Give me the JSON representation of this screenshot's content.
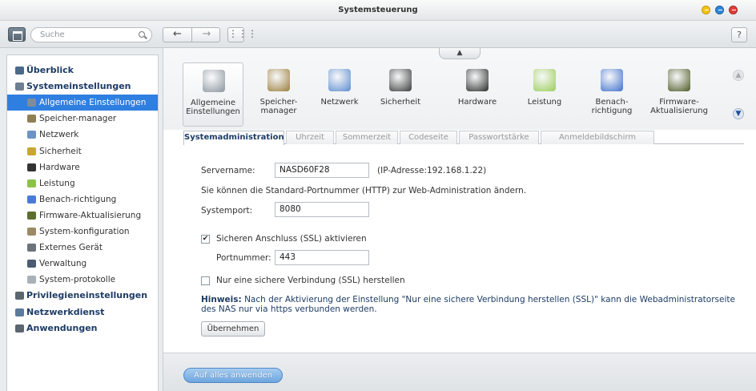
{
  "window": {
    "title": "Systemsteuerung"
  },
  "toolbar": {
    "search_placeholder": "Suche",
    "back": "←",
    "forward": "→",
    "grid": "⋮⋮⋮",
    "help": "?"
  },
  "sidebar": {
    "items": [
      {
        "label": "Überblick",
        "level": 0,
        "icon": "overview-icon",
        "color": "#4a6a8c"
      },
      {
        "label": "Systemeinstellungen",
        "level": 0,
        "icon": "gear-icon",
        "color": "#6d7f93"
      },
      {
        "label": "Allgemeine Einstellungen",
        "level": 1,
        "icon": "general-settings-icon",
        "color": "#7f8c99",
        "selected": true
      },
      {
        "label": "Speicher-manager",
        "level": 1,
        "icon": "storage-icon",
        "color": "#8e7f55"
      },
      {
        "label": "Netzwerk",
        "level": 1,
        "icon": "network-icon",
        "color": "#6d93c4"
      },
      {
        "label": "Sicherheit",
        "level": 1,
        "icon": "lock-icon",
        "color": "#c9a62d"
      },
      {
        "label": "Hardware",
        "level": 1,
        "icon": "hardware-icon",
        "color": "#333333"
      },
      {
        "label": "Leistung",
        "level": 1,
        "icon": "bulb-icon",
        "color": "#8bc34a"
      },
      {
        "label": "Benach-richtigung",
        "level": 1,
        "icon": "notification-icon",
        "color": "#4b7ad6"
      },
      {
        "label": "Firmware-Aktualisierung",
        "level": 1,
        "icon": "firmware-icon",
        "color": "#5c6e2d"
      },
      {
        "label": "System-konfiguration",
        "level": 1,
        "icon": "system-config-icon",
        "color": "#9c8a62"
      },
      {
        "label": "Externes Gerät",
        "level": 1,
        "icon": "external-device-icon",
        "color": "#6b737b"
      },
      {
        "label": "Verwaltung",
        "level": 1,
        "icon": "management-icon",
        "color": "#4a5b73"
      },
      {
        "label": "System-protokolle",
        "level": 1,
        "icon": "logs-icon",
        "color": "#a9b1b8"
      },
      {
        "label": "Privilegieneinstellungen",
        "level": 0,
        "icon": "user-icon",
        "color": "#5a6670"
      },
      {
        "label": "Netzwerkdienst",
        "level": 0,
        "icon": "network-service-icon",
        "color": "#5a7b9c"
      },
      {
        "label": "Anwendungen",
        "level": 0,
        "icon": "applications-icon",
        "color": "#5a6670"
      }
    ]
  },
  "categories": [
    {
      "label": "Allgemeine\nEinstellungen",
      "icon": "general-settings-icon",
      "color": "#8a949e",
      "selected": true
    },
    {
      "label": "Speicher-\nmanager",
      "icon": "storage-icon",
      "color": "#9b7d3a"
    },
    {
      "label": "Netzwerk",
      "icon": "network-icon",
      "color": "#5b8bd0"
    },
    {
      "label": "Sicherheit",
      "icon": "lock-icon",
      "color": "#3a3a3a"
    },
    {
      "label": "Hardware",
      "icon": "hardware-icon",
      "color": "#2a2a2a"
    },
    {
      "label": "Leistung",
      "icon": "bulb-icon",
      "color": "#9acd5a"
    },
    {
      "label": "Benach-\nrichtigung",
      "icon": "notification-icon",
      "color": "#3f6fcf"
    },
    {
      "label": "Firmware-\nAktualisierung",
      "icon": "firmware-icon",
      "color": "#4c5a24"
    }
  ],
  "tabs": [
    {
      "label": "Systemadministration",
      "active": true
    },
    {
      "label": "Uhrzeit"
    },
    {
      "label": "Sommerzeit"
    },
    {
      "label": "Codeseite"
    },
    {
      "label": "Passwortstärke"
    },
    {
      "label": "Anmeldebildschirm"
    }
  ],
  "form": {
    "servername_label": "Servername:",
    "servername_value": "NASD60F28",
    "ip_text": "(IP-Adresse:192.168.1.22)",
    "port_info": "Sie können die Standard-Portnummer (HTTP) zur Web-Administration ändern.",
    "systemport_label": "Systemport:",
    "systemport_value": "8080",
    "ssl_checkbox_label": "Sicheren Anschluss (SSL) aktivieren",
    "ssl_checked": true,
    "portnummer_label": "Portnummer:",
    "portnummer_value": "443",
    "ssl_only_label": "Nur eine sichere Verbindung (SSL) herstellen",
    "ssl_only_checked": false,
    "hint_title": "Hinweis:",
    "hint_text": " Nach der Aktivierung der Einstellung \"Nur eine sichere Verbindung herstellen (SSL)\" kann die Webadministratorseite des NAS nur via https verbunden werden.",
    "apply_label": "Übernehmen"
  },
  "footer": {
    "apply_all_label": "Auf alles anwenden"
  }
}
